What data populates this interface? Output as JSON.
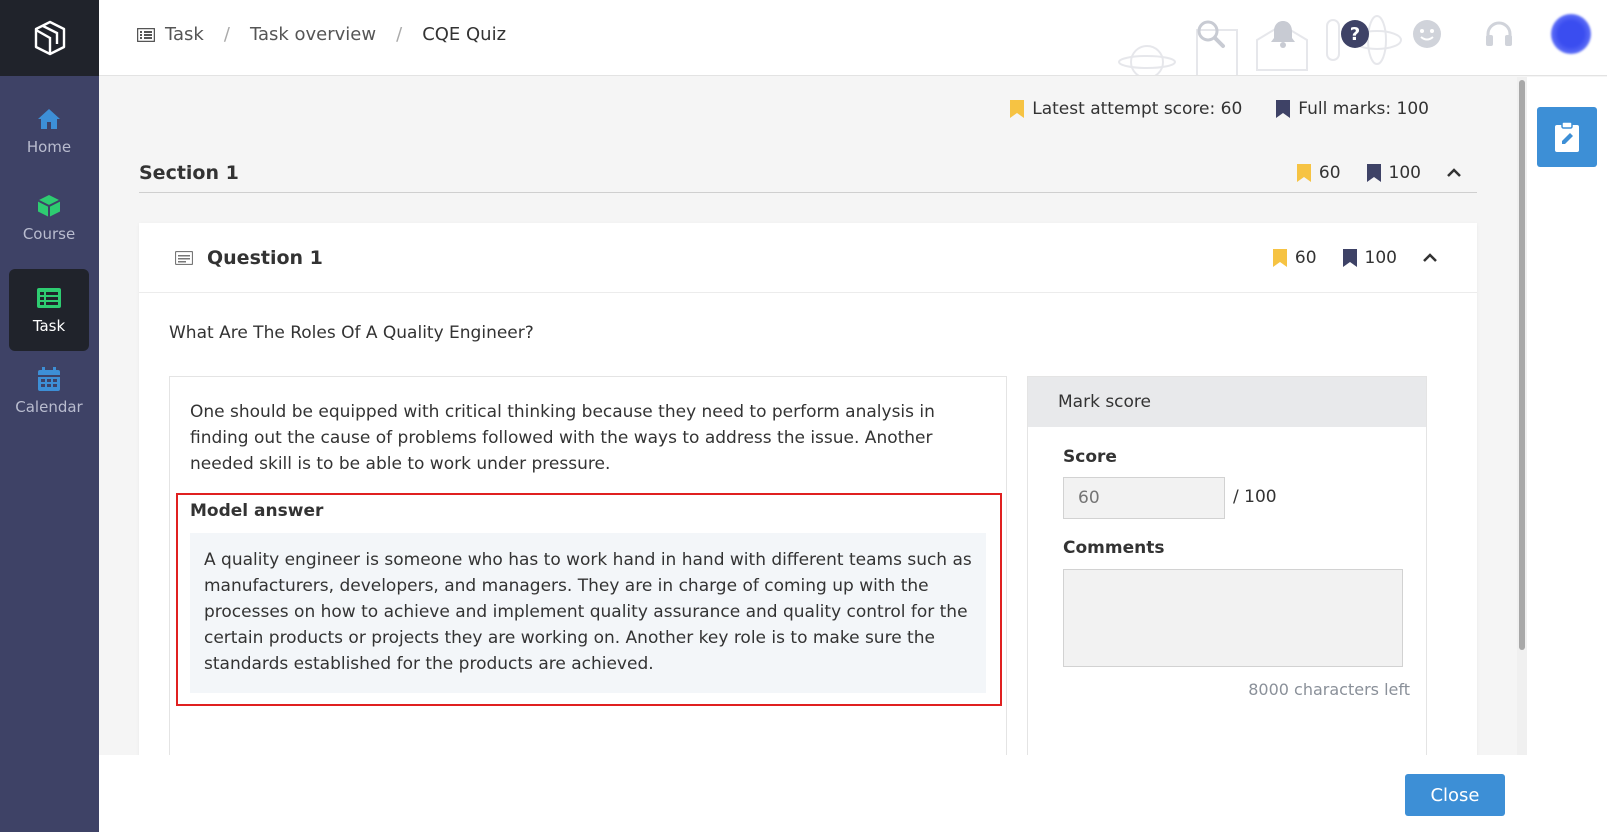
{
  "sidebar": {
    "logo_icon": "cube-box-logo",
    "items": [
      {
        "label": "Home",
        "icon": "home-icon",
        "color": "#3d8fd6",
        "active": false
      },
      {
        "label": "Course",
        "icon": "cube-icon",
        "color": "#2ecc71",
        "active": false
      },
      {
        "label": "Task",
        "icon": "task-list-icon",
        "color": "#2ecc71",
        "active": true
      },
      {
        "label": "Calendar",
        "icon": "calendar-icon",
        "color": "#3d8fd6",
        "active": false
      }
    ]
  },
  "breadcrumb": {
    "icon": "task-list-icon",
    "items": [
      "Task",
      "Task overview",
      "CQE Quiz"
    ],
    "separator": "/"
  },
  "topbar": {
    "icons": [
      "search-icon",
      "bell-icon",
      "help-icon",
      "smiley-icon",
      "headset-icon",
      "avatar"
    ]
  },
  "summary": {
    "latest_attempt": "Latest attempt score: 60",
    "full_marks": "Full marks: 100"
  },
  "section": {
    "title": "Section 1",
    "score": "60",
    "full": "100"
  },
  "question": {
    "title": "Question 1",
    "score": "60",
    "full": "100",
    "text": "What Are The Roles Of A Quality Engineer?",
    "student_answer": "One should be equipped with critical thinking because they need to perform analysis in finding out the cause of problems followed with the ways to address the issue. Another needed skill is to be able to work under pressure.",
    "model_answer_label": "Model answer",
    "model_answer": "A quality engineer is someone who has to work hand in hand with different teams such as manufacturers, developers, and managers. They are in charge of coming up with the processes on how to achieve and implement quality assurance and quality control for the certain products or projects they are working on. Another key role is to make sure the standards established for the products are achieved."
  },
  "mark_panel": {
    "title": "Mark score",
    "score_label": "Score",
    "score_placeholder": "60",
    "score_max": "/ 100",
    "comments_label": "Comments",
    "chars_left": "8000 characters left"
  },
  "footer": {
    "close_label": "Close"
  },
  "colors": {
    "accent": "#3d8fd6",
    "bookmark_yellow": "#f6c343",
    "bookmark_dark": "#3e4266",
    "highlight_border": "#e02020",
    "sidebar_bg": "#3e4266"
  }
}
